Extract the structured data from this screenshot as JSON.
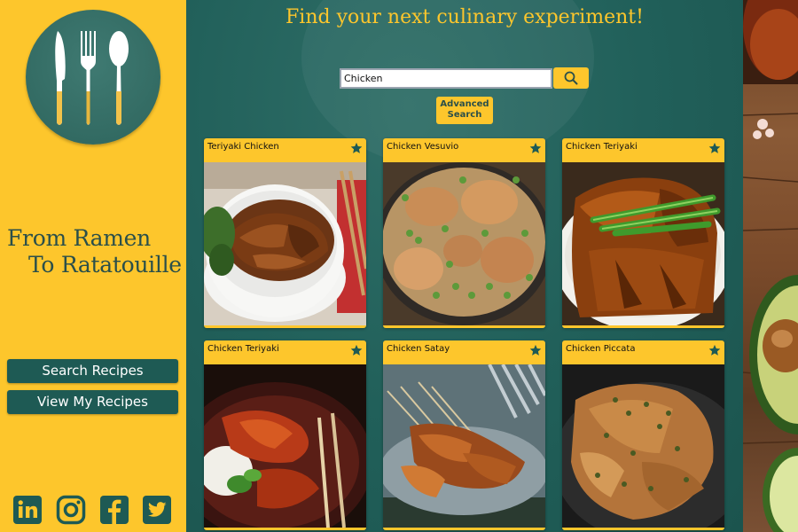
{
  "sidebar": {
    "brand_line1": "From Ramen",
    "brand_line2": "To Ratatouille",
    "nav": [
      {
        "label": "Search Recipes"
      },
      {
        "label": "View My Recipes"
      }
    ],
    "social": [
      "linkedin-icon",
      "instagram-icon",
      "facebook-icon",
      "twitter-icon"
    ]
  },
  "main": {
    "headline": "Find your next culinary experiment!",
    "search": {
      "value": "Chicken",
      "button_icon": "search-icon"
    },
    "advanced_label_1": "Advanced",
    "advanced_label_2": "Search",
    "cards": [
      {
        "title": "Teriyaki Chicken"
      },
      {
        "title": "Chicken Vesuvio"
      },
      {
        "title": "Chicken Teriyaki"
      },
      {
        "title": "Chicken Teriyaki"
      },
      {
        "title": "Chicken Satay"
      },
      {
        "title": "Chicken Piccata"
      }
    ]
  },
  "colors": {
    "accent_yellow": "#fdc62c",
    "dark_teal": "#1e5a54",
    "background_teal": "#21605a"
  }
}
